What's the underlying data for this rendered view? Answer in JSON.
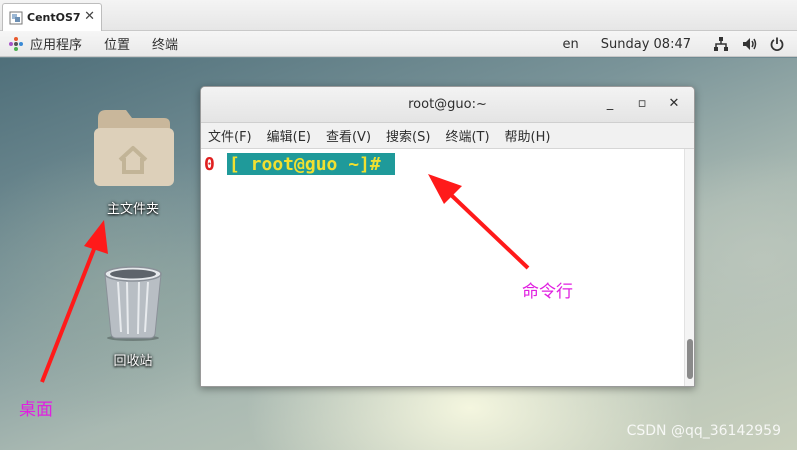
{
  "vm_tab": {
    "label": "CentOS7",
    "close": "✕"
  },
  "panel": {
    "menus": [
      "应用程序",
      "位置",
      "终端"
    ],
    "keyboard_layout": "en",
    "clock": "Sunday 08:47"
  },
  "desktop": {
    "icons": [
      {
        "label": "主文件夹",
        "icon": "home-folder-icon"
      },
      {
        "label": "回收站",
        "icon": "trash-icon"
      }
    ]
  },
  "terminal": {
    "title": "root@guo:~",
    "window_buttons": {
      "minimize": "_",
      "maximize": "▫",
      "close": "✕"
    },
    "menus": [
      "文件(F)",
      "编辑(E)",
      "查看(V)",
      "搜索(S)",
      "终端(T)",
      "帮助(H)"
    ],
    "prompt_prefix": "0",
    "prompt": "[ root@guo ~]#"
  },
  "annotations": {
    "command_line": "命令行",
    "desktop": "桌面",
    "arrow_color": "#ff1a1a",
    "label_color": "#e020e0"
  },
  "watermark": "CSDN @qq_36142959",
  "colors": {
    "prompt_bg": "#1f9a9a",
    "prompt_text": "#f0e030",
    "prompt_zero": "#e02020"
  }
}
